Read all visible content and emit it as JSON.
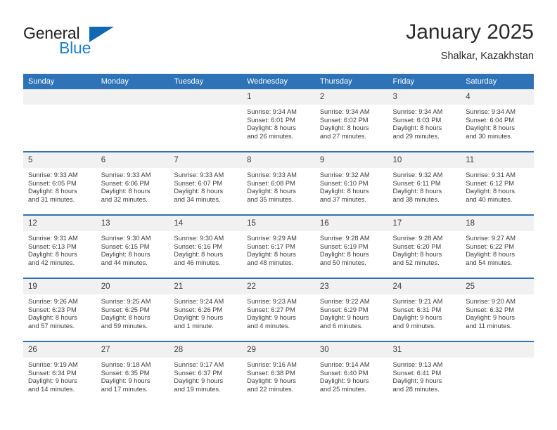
{
  "brand": {
    "name_part1": "General",
    "name_part2": "Blue",
    "triangle_icon": "triangle-icon",
    "colors": {
      "dark": "#231f20",
      "blue": "#1b7fd4",
      "triangle": "#1267b2"
    }
  },
  "header": {
    "title": "January 2025",
    "subtitle": "Shalkar, Kazakhstan"
  },
  "theme": {
    "header_blue": "#2e72b8",
    "daynum_band": "#f1f1f1",
    "text": "#3d3d3d"
  },
  "weekdays": [
    "Sunday",
    "Monday",
    "Tuesday",
    "Wednesday",
    "Thursday",
    "Friday",
    "Saturday"
  ],
  "weeks": [
    [
      {
        "day": "",
        "blank": true
      },
      {
        "day": "",
        "blank": true
      },
      {
        "day": "",
        "blank": true
      },
      {
        "day": "1",
        "sunrise": "Sunrise: 9:34 AM",
        "sunset": "Sunset: 6:01 PM",
        "daylight1": "Daylight: 8 hours",
        "daylight2": "and 26 minutes."
      },
      {
        "day": "2",
        "sunrise": "Sunrise: 9:34 AM",
        "sunset": "Sunset: 6:02 PM",
        "daylight1": "Daylight: 8 hours",
        "daylight2": "and 27 minutes."
      },
      {
        "day": "3",
        "sunrise": "Sunrise: 9:34 AM",
        "sunset": "Sunset: 6:03 PM",
        "daylight1": "Daylight: 8 hours",
        "daylight2": "and 29 minutes."
      },
      {
        "day": "4",
        "sunrise": "Sunrise: 9:34 AM",
        "sunset": "Sunset: 6:04 PM",
        "daylight1": "Daylight: 8 hours",
        "daylight2": "and 30 minutes."
      }
    ],
    [
      {
        "day": "5",
        "sunrise": "Sunrise: 9:33 AM",
        "sunset": "Sunset: 6:05 PM",
        "daylight1": "Daylight: 8 hours",
        "daylight2": "and 31 minutes."
      },
      {
        "day": "6",
        "sunrise": "Sunrise: 9:33 AM",
        "sunset": "Sunset: 6:06 PM",
        "daylight1": "Daylight: 8 hours",
        "daylight2": "and 32 minutes."
      },
      {
        "day": "7",
        "sunrise": "Sunrise: 9:33 AM",
        "sunset": "Sunset: 6:07 PM",
        "daylight1": "Daylight: 8 hours",
        "daylight2": "and 34 minutes."
      },
      {
        "day": "8",
        "sunrise": "Sunrise: 9:33 AM",
        "sunset": "Sunset: 6:08 PM",
        "daylight1": "Daylight: 8 hours",
        "daylight2": "and 35 minutes."
      },
      {
        "day": "9",
        "sunrise": "Sunrise: 9:32 AM",
        "sunset": "Sunset: 6:10 PM",
        "daylight1": "Daylight: 8 hours",
        "daylight2": "and 37 minutes."
      },
      {
        "day": "10",
        "sunrise": "Sunrise: 9:32 AM",
        "sunset": "Sunset: 6:11 PM",
        "daylight1": "Daylight: 8 hours",
        "daylight2": "and 38 minutes."
      },
      {
        "day": "11",
        "sunrise": "Sunrise: 9:31 AM",
        "sunset": "Sunset: 6:12 PM",
        "daylight1": "Daylight: 8 hours",
        "daylight2": "and 40 minutes."
      }
    ],
    [
      {
        "day": "12",
        "sunrise": "Sunrise: 9:31 AM",
        "sunset": "Sunset: 6:13 PM",
        "daylight1": "Daylight: 8 hours",
        "daylight2": "and 42 minutes."
      },
      {
        "day": "13",
        "sunrise": "Sunrise: 9:30 AM",
        "sunset": "Sunset: 6:15 PM",
        "daylight1": "Daylight: 8 hours",
        "daylight2": "and 44 minutes."
      },
      {
        "day": "14",
        "sunrise": "Sunrise: 9:30 AM",
        "sunset": "Sunset: 6:16 PM",
        "daylight1": "Daylight: 8 hours",
        "daylight2": "and 46 minutes."
      },
      {
        "day": "15",
        "sunrise": "Sunrise: 9:29 AM",
        "sunset": "Sunset: 6:17 PM",
        "daylight1": "Daylight: 8 hours",
        "daylight2": "and 48 minutes."
      },
      {
        "day": "16",
        "sunrise": "Sunrise: 9:28 AM",
        "sunset": "Sunset: 6:19 PM",
        "daylight1": "Daylight: 8 hours",
        "daylight2": "and 50 minutes."
      },
      {
        "day": "17",
        "sunrise": "Sunrise: 9:28 AM",
        "sunset": "Sunset: 6:20 PM",
        "daylight1": "Daylight: 8 hours",
        "daylight2": "and 52 minutes."
      },
      {
        "day": "18",
        "sunrise": "Sunrise: 9:27 AM",
        "sunset": "Sunset: 6:22 PM",
        "daylight1": "Daylight: 8 hours",
        "daylight2": "and 54 minutes."
      }
    ],
    [
      {
        "day": "19",
        "sunrise": "Sunrise: 9:26 AM",
        "sunset": "Sunset: 6:23 PM",
        "daylight1": "Daylight: 8 hours",
        "daylight2": "and 57 minutes."
      },
      {
        "day": "20",
        "sunrise": "Sunrise: 9:25 AM",
        "sunset": "Sunset: 6:25 PM",
        "daylight1": "Daylight: 8 hours",
        "daylight2": "and 59 minutes."
      },
      {
        "day": "21",
        "sunrise": "Sunrise: 9:24 AM",
        "sunset": "Sunset: 6:26 PM",
        "daylight1": "Daylight: 9 hours",
        "daylight2": "and 1 minute."
      },
      {
        "day": "22",
        "sunrise": "Sunrise: 9:23 AM",
        "sunset": "Sunset: 6:27 PM",
        "daylight1": "Daylight: 9 hours",
        "daylight2": "and 4 minutes."
      },
      {
        "day": "23",
        "sunrise": "Sunrise: 9:22 AM",
        "sunset": "Sunset: 6:29 PM",
        "daylight1": "Daylight: 9 hours",
        "daylight2": "and 6 minutes."
      },
      {
        "day": "24",
        "sunrise": "Sunrise: 9:21 AM",
        "sunset": "Sunset: 6:31 PM",
        "daylight1": "Daylight: 9 hours",
        "daylight2": "and 9 minutes."
      },
      {
        "day": "25",
        "sunrise": "Sunrise: 9:20 AM",
        "sunset": "Sunset: 6:32 PM",
        "daylight1": "Daylight: 9 hours",
        "daylight2": "and 11 minutes."
      }
    ],
    [
      {
        "day": "26",
        "sunrise": "Sunrise: 9:19 AM",
        "sunset": "Sunset: 6:34 PM",
        "daylight1": "Daylight: 9 hours",
        "daylight2": "and 14 minutes."
      },
      {
        "day": "27",
        "sunrise": "Sunrise: 9:18 AM",
        "sunset": "Sunset: 6:35 PM",
        "daylight1": "Daylight: 9 hours",
        "daylight2": "and 17 minutes."
      },
      {
        "day": "28",
        "sunrise": "Sunrise: 9:17 AM",
        "sunset": "Sunset: 6:37 PM",
        "daylight1": "Daylight: 9 hours",
        "daylight2": "and 19 minutes."
      },
      {
        "day": "29",
        "sunrise": "Sunrise: 9:16 AM",
        "sunset": "Sunset: 6:38 PM",
        "daylight1": "Daylight: 9 hours",
        "daylight2": "and 22 minutes."
      },
      {
        "day": "30",
        "sunrise": "Sunrise: 9:14 AM",
        "sunset": "Sunset: 6:40 PM",
        "daylight1": "Daylight: 9 hours",
        "daylight2": "and 25 minutes."
      },
      {
        "day": "31",
        "sunrise": "Sunrise: 9:13 AM",
        "sunset": "Sunset: 6:41 PM",
        "daylight1": "Daylight: 9 hours",
        "daylight2": "and 28 minutes."
      },
      {
        "day": "",
        "blank": true
      }
    ]
  ]
}
